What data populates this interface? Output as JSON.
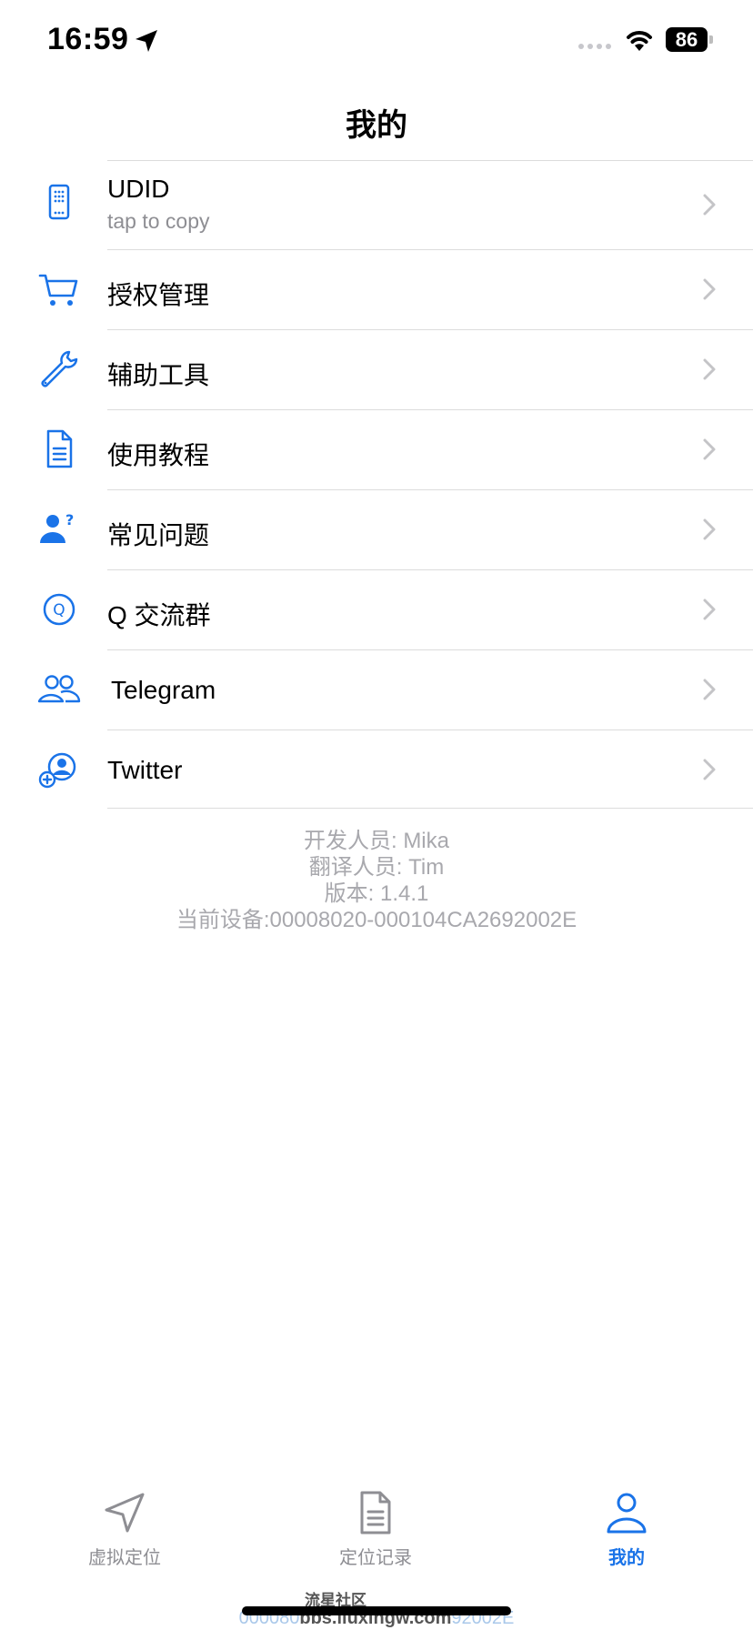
{
  "status_bar": {
    "time": "16:59",
    "battery": "86"
  },
  "header": {
    "title": "我的"
  },
  "menu": [
    {
      "label": "UDID",
      "sublabel": "tap to copy",
      "icon": "phone-icon"
    },
    {
      "label": "授权管理",
      "icon": "cart-icon"
    },
    {
      "label": "辅助工具",
      "icon": "wrench-icon"
    },
    {
      "label": "使用教程",
      "icon": "document-icon"
    },
    {
      "label": "常见问题",
      "icon": "person-question-icon"
    },
    {
      "label": "Q 交流群",
      "icon": "q-circle-icon"
    },
    {
      "label": "Telegram",
      "icon": "people-icon"
    },
    {
      "label": "Twitter",
      "icon": "person-add-icon"
    }
  ],
  "info": {
    "developer": "开发人员: Mika",
    "translator": "翻译人员: Tim",
    "version": "版本: 1.4.1",
    "device": "当前设备:00008020-000104CA2692002E"
  },
  "tabs": [
    {
      "label": "虚拟定位",
      "icon": "location-arrow-icon",
      "active": false
    },
    {
      "label": "定位记录",
      "icon": "document-icon",
      "active": false
    },
    {
      "label": "我的",
      "icon": "person-icon",
      "active": true
    }
  ],
  "watermark": {
    "brand": "流星社区",
    "url_left": "000080",
    "url_mid": "bbs.liuxingw.com",
    "url_right": "92002E"
  },
  "colors": {
    "accent": "#1a73e8",
    "inactive": "#8e8e93",
    "info_text": "#a8a8ad"
  }
}
